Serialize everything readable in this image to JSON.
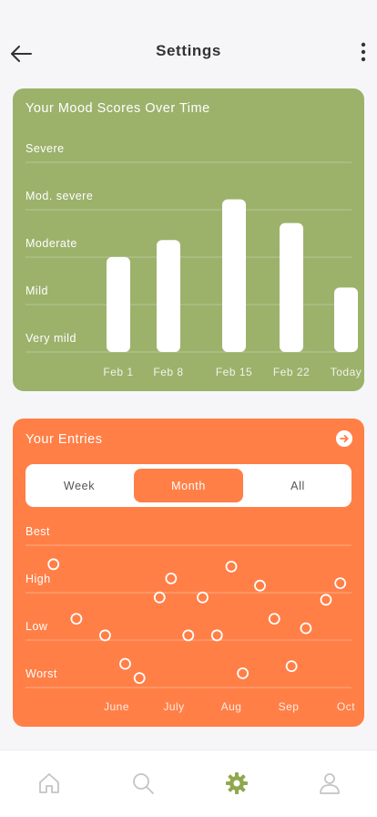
{
  "header": {
    "title": "Settings"
  },
  "mood_card": {
    "title": "Your Mood Scores Over Time"
  },
  "entries_card": {
    "title": "Your Entries",
    "tabs": [
      {
        "label": "Week",
        "active": false
      },
      {
        "label": "Month",
        "active": true
      },
      {
        "label": "All",
        "active": false
      }
    ]
  },
  "colors": {
    "mood_card_bg": "#9cb26b",
    "entries_card_bg": "#ff7f46",
    "active_nav": "#8fa84f",
    "inactive_nav": "#c4c4c4"
  },
  "nav": {
    "items": [
      "home-icon",
      "search-icon",
      "gear-icon",
      "person-icon"
    ],
    "active": "gear-icon"
  },
  "chart_data": [
    {
      "type": "bar",
      "title": "Your Mood Scores Over Time",
      "categories": [
        "Feb 1",
        "Feb 8",
        "Feb 15",
        "Feb 22",
        "Today"
      ],
      "y_levels": [
        "Very mild",
        "Mild",
        "Moderate",
        "Mod. severe",
        "Severe"
      ],
      "values": [
        2.8,
        3.3,
        4.5,
        3.8,
        1.9
      ],
      "ylim": [
        0,
        5
      ],
      "grid": true
    },
    {
      "type": "scatter",
      "title": "Your Entries",
      "categories": [
        "June",
        "July",
        "Aug",
        "Sep",
        "Oct"
      ],
      "y_levels": [
        "Worst",
        "Low",
        "High",
        "Best"
      ],
      "ylim": [
        0,
        4
      ],
      "grid": true,
      "points": [
        {
          "x": -1.1,
          "y": 2.6
        },
        {
          "x": -0.7,
          "y": 1.45
        },
        {
          "x": -0.2,
          "y": 1.1
        },
        {
          "x": 0.15,
          "y": 0.5
        },
        {
          "x": 0.4,
          "y": 0.2
        },
        {
          "x": 0.75,
          "y": 1.9
        },
        {
          "x": 0.95,
          "y": 2.3
        },
        {
          "x": 1.25,
          "y": 1.1
        },
        {
          "x": 1.5,
          "y": 1.9
        },
        {
          "x": 1.75,
          "y": 1.1
        },
        {
          "x": 2.0,
          "y": 2.55
        },
        {
          "x": 2.2,
          "y": 0.3
        },
        {
          "x": 2.5,
          "y": 2.15
        },
        {
          "x": 2.75,
          "y": 1.45
        },
        {
          "x": 3.05,
          "y": 0.45
        },
        {
          "x": 3.3,
          "y": 1.25
        },
        {
          "x": 3.65,
          "y": 1.85
        },
        {
          "x": 3.9,
          "y": 2.2
        }
      ]
    }
  ]
}
